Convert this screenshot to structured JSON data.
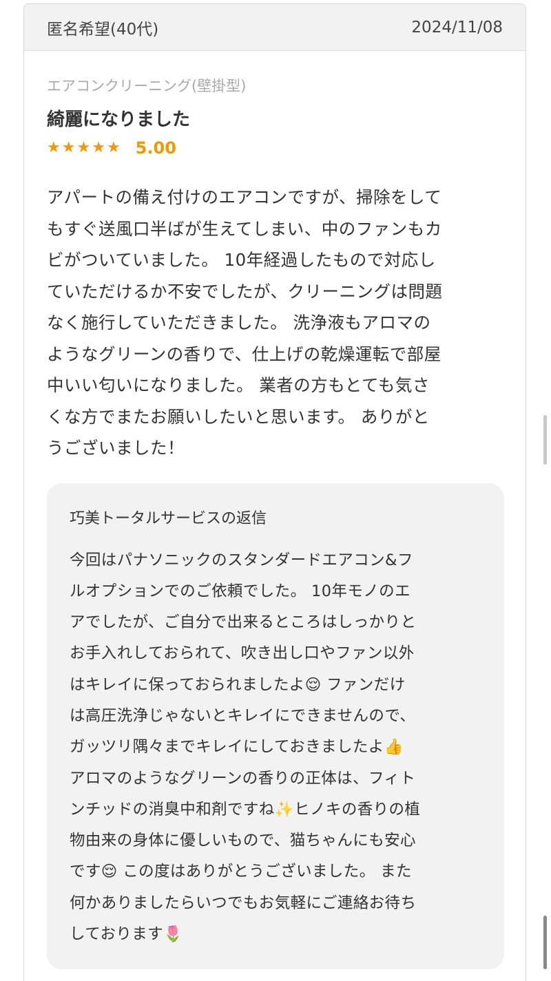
{
  "review": {
    "author": "匿名希望(40代)",
    "date": "2024/11/08",
    "category": "エアコンクリーニング(壁掛型)",
    "title": "綺麗になりました",
    "stars": 5,
    "score": "5.00",
    "body": "アパートの備え付けのエアコンですが、掃除をして\nもすぐ送風口半ばが生えてしまい、中のファンもカ\nビがついていました。 10年経過したもので対応し\nていただけるか不安でしたが、クリーニングは問題\nなく施行していただきました。 洗浄液もアロマの\nようなグリーンの香りで、仕上げの乾燥運転で部屋\n中いい匂いになりました。 業者の方もとても気さ\nくな方でまたお願いしたいと思います。 ありがと\nうございました！"
  },
  "reply": {
    "title": "巧美トータルサービスの返信",
    "body": "今回はパナソニックのスタンダードエアコン&フ\nルオプションでのご依頼でした。 10年モノのエ\nアでしたが、ご自分で出来るところはしっかりと\nお手入れしておられて、吹き出し口やファン以外\nはキレイに保っておられましたよ😌 ファンだけ\nは高圧洗浄じゃないとキレイにできませんので、\nガッツリ隅々までキレイにしておきましたよ👍\nアロマのようなグリーンの香りの正体は、フィト\nンチッドの消臭中和剤ですね✨ヒノキの香りの植\n物由来の身体に優しいもので、猫ちゃんにも安心\nです😌 この度はありがとうございました。 また\n何かありましたらいつでもお気軽にご連絡お待ち\nしております🌷"
  },
  "colors": {
    "accent": "#f39800",
    "header_bg": "#f2f2f2",
    "reply_bg": "#f2f2f2"
  },
  "icons": {
    "star": "star-icon"
  }
}
